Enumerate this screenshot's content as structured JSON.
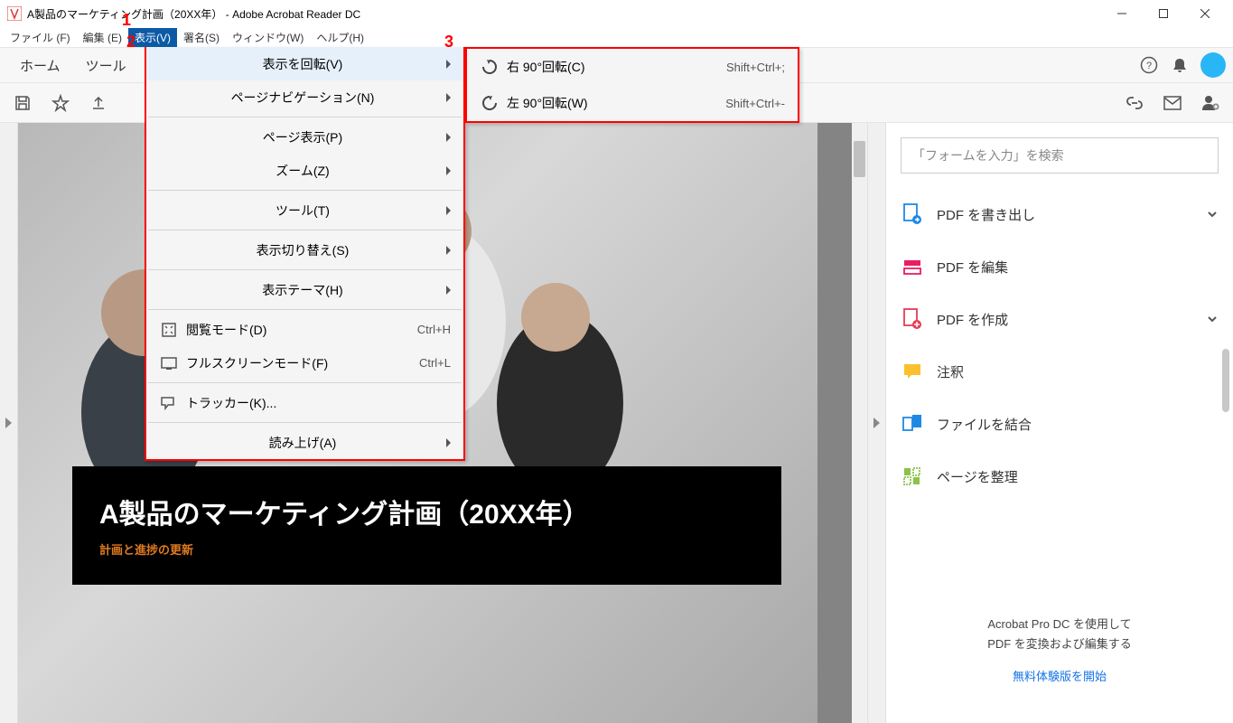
{
  "window": {
    "title": "A製品のマーケティング計画（20XX年）  - Adobe Acrobat Reader DC"
  },
  "menubar": {
    "items": [
      {
        "label": "ファイル (F)"
      },
      {
        "label": "編集 (E)"
      },
      {
        "label": "表示(V)",
        "active": true
      },
      {
        "label": "署名(S)"
      },
      {
        "label": "ウィンドウ(W)"
      },
      {
        "label": "ヘルプ(H)"
      }
    ]
  },
  "secbar": {
    "home": "ホーム",
    "tools": "ツール"
  },
  "view_menu": {
    "items": [
      {
        "label": "表示を回転(V)",
        "arrow": true,
        "hover": true
      },
      {
        "label": "ページナビゲーション(N)",
        "arrow": true
      },
      {
        "label": "ページ表示(P)",
        "arrow": true
      },
      {
        "label": "ズーム(Z)",
        "arrow": true
      },
      {
        "label": "ツール(T)",
        "arrow": true
      },
      {
        "label": "表示切り替え(S)",
        "arrow": true
      },
      {
        "label": "表示テーマ(H)",
        "arrow": true
      },
      {
        "label": "閲覧モード(D)",
        "shortcut": "Ctrl+H",
        "icon": "read"
      },
      {
        "label": "フルスクリーンモード(F)",
        "shortcut": "Ctrl+L",
        "icon": "fullscreen"
      },
      {
        "label": "トラッカー(K)...",
        "icon": "tracker"
      },
      {
        "label": "読み上げ(A)",
        "arrow": true
      }
    ]
  },
  "rotate_submenu": {
    "items": [
      {
        "label": "右 90°回転(C)",
        "shortcut": "Shift+Ctrl+;",
        "icon": "cw"
      },
      {
        "label": "左 90°回転(W)",
        "shortcut": "Shift+Ctrl+-",
        "icon": "ccw"
      }
    ]
  },
  "document": {
    "banner_title": "A製品のマーケティング計画（20XX年）",
    "banner_sub": "計画と進捗の更新"
  },
  "rightpanel": {
    "search_placeholder": "「フォームを入力」を検索",
    "tools": [
      {
        "label": "PDF を書き出し",
        "chev": true,
        "color": "#1e88e5"
      },
      {
        "label": "PDF を編集",
        "color": "#e91e63"
      },
      {
        "label": "PDF を作成",
        "chev": true,
        "color": "#e73b55"
      },
      {
        "label": "注釈",
        "color": "#fbc02d"
      },
      {
        "label": "ファイルを結合",
        "color": "#1e88e5"
      },
      {
        "label": "ページを整理",
        "color": "#8bc34a"
      }
    ],
    "promo_line1": "Acrobat Pro DC を使用して",
    "promo_line2": "PDF を変換および編集する",
    "promo_link": "無料体験版を開始"
  },
  "annotations": {
    "n1": "1",
    "n2": "2",
    "n3": "3"
  }
}
